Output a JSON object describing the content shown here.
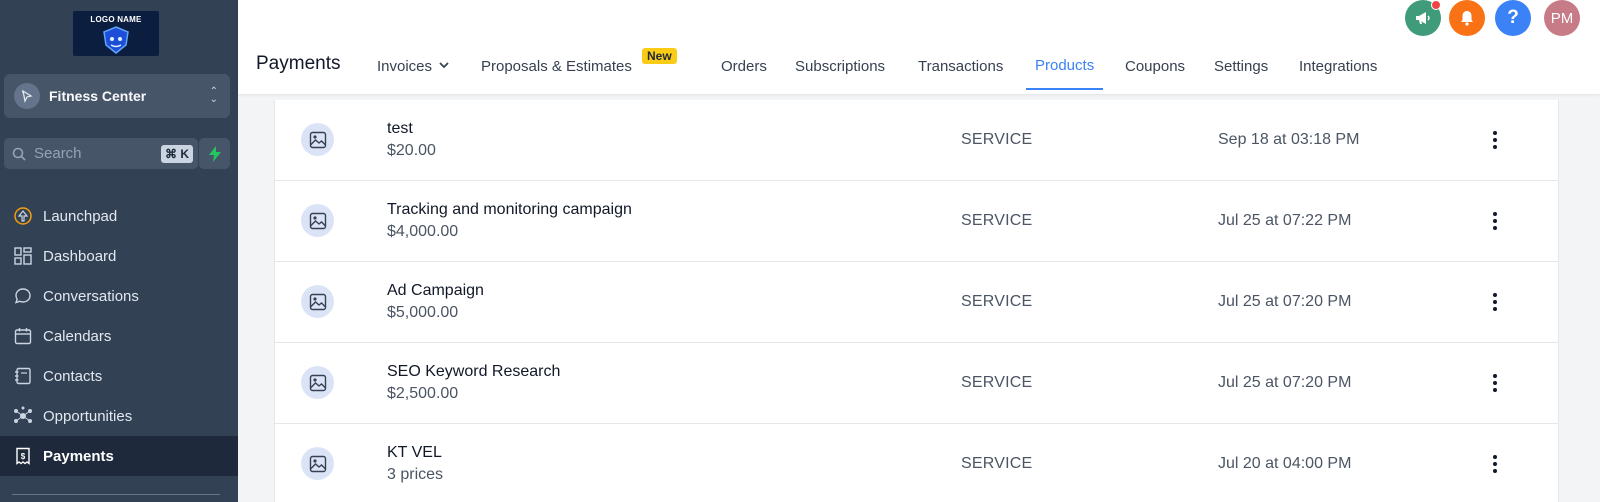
{
  "sidebar": {
    "logo_text": "LOGO NAME",
    "location": {
      "name": "Fitness Center"
    },
    "search": {
      "placeholder": "Search",
      "shortcut": "⌘ K"
    },
    "nav": [
      {
        "label": "Launchpad",
        "icon": "launchpad-icon",
        "active": false
      },
      {
        "label": "Dashboard",
        "icon": "dashboard-grid-icon",
        "active": false
      },
      {
        "label": "Conversations",
        "icon": "chat-bubble-icon",
        "active": false
      },
      {
        "label": "Calendars",
        "icon": "calendar-icon",
        "active": false
      },
      {
        "label": "Contacts",
        "icon": "contacts-book-icon",
        "active": false
      },
      {
        "label": "Opportunities",
        "icon": "opportunities-icon",
        "active": false
      },
      {
        "label": "Payments",
        "icon": "payments-receipt-icon",
        "active": true
      }
    ]
  },
  "header": {
    "title": "Payments",
    "tabs": [
      {
        "label": "Invoices",
        "has_dropdown": true
      },
      {
        "label": "Proposals & Estimates",
        "badge": "New"
      },
      {
        "label": "Orders"
      },
      {
        "label": "Subscriptions"
      },
      {
        "label": "Transactions"
      },
      {
        "label": "Products",
        "active": true
      },
      {
        "label": "Coupons"
      },
      {
        "label": "Settings"
      },
      {
        "label": "Integrations"
      }
    ],
    "avatar_initials": "PM",
    "colors": {
      "announce": "#3f9b7a",
      "bell": "#f97316",
      "help": "#3b82f6",
      "avatar": "#c77b86",
      "accent": "#3b82f6"
    }
  },
  "products": [
    {
      "name": "test",
      "price": "$20.00",
      "type": "SERVICE",
      "date": "Sep 18 at 03:18 PM"
    },
    {
      "name": "Tracking and monitoring campaign",
      "price": "$4,000.00",
      "type": "SERVICE",
      "date": "Jul 25 at 07:22 PM"
    },
    {
      "name": "Ad Campaign",
      "price": "$5,000.00",
      "type": "SERVICE",
      "date": "Jul 25 at 07:20 PM"
    },
    {
      "name": "SEO Keyword Research",
      "price": "$2,500.00",
      "type": "SERVICE",
      "date": "Jul 25 at 07:20 PM"
    },
    {
      "name": "KT VEL",
      "price": "3 prices",
      "type": "SERVICE",
      "date": "Jul 20 at 04:00 PM"
    }
  ]
}
